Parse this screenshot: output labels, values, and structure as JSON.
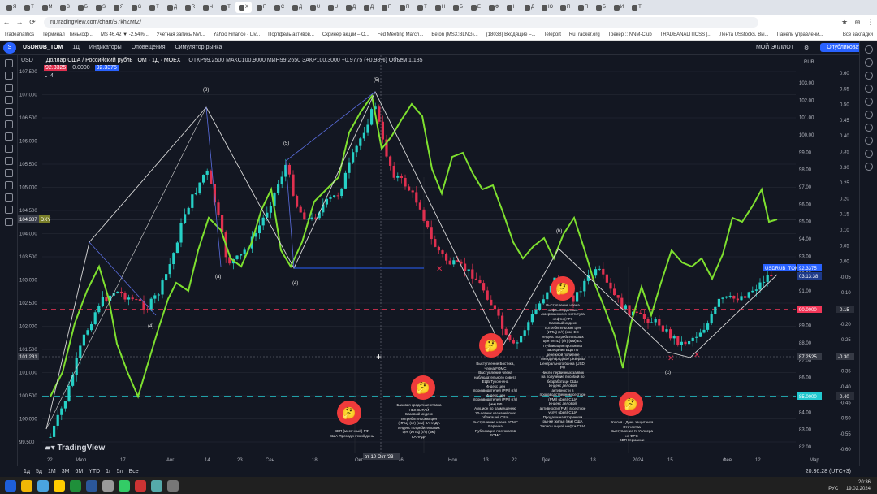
{
  "browser": {
    "tab_labels": [
      "Я",
      "Т",
      "М",
      "В",
      "Б",
      "S",
      "Я",
      "G",
      "T",
      "Д",
      "R",
      "Ч",
      "Т",
      "Х",
      "П",
      "С",
      "Д",
      "U",
      "U",
      "Д",
      "Д",
      "П",
      "П",
      "Т",
      "Н",
      "Б",
      "Е",
      "Ф",
      "Н",
      "Д",
      "Ю",
      "П",
      "П",
      "Б",
      "И",
      "Т"
    ],
    "url": "ru.tradingview.com/chart/S7khZMfZ/",
    "bookmarks": [
      "Tradeanalitics",
      "Терминал | Тинькоф...",
      "MS 46.42 ▼ -2.54%...",
      "Учетная запись NVI...",
      "Yahoo Finance - Liv...",
      "Портфель активов...",
      "Скринер акций – О...",
      "Fed Meeting March...",
      "Beton (MSX:BLNG)...",
      "(18038) Входящие –...",
      "Teleport",
      "RuTracker.org",
      "Трекер :: NNM-Club",
      "TRADEANALITICSS |...",
      "Лента USstocks. Вы...",
      "Панель управлени..."
    ],
    "bookmarks_all": "Все закладки"
  },
  "toolbar": {
    "symbol": "USDRUB_TOM",
    "interval": "1Д",
    "indicators": "Индикаторы",
    "alerts": "Оповещения",
    "replay": "Симулятор рынка",
    "layout_name": "МОЙ ЭЛЛИОТ",
    "publish": "Опубликовать"
  },
  "legend": {
    "title": "Доллар США / Российский рубль TOM · 1Д · MOEX",
    "ohlc": "ОТКР99.2500  МАКС100.9000  МИН99.2650  ЗАКР100.3000  +0.9775 (+0.98%)  Объём  1.185",
    "price_a": "92.3325",
    "price_b": "0.0000",
    "price_c": "92.3375",
    "indicator_count": "4"
  },
  "left_axis": {
    "currency": "USD",
    "labels": [
      "107.500",
      "107.000",
      "106.500",
      "106.000",
      "105.500",
      "105.000",
      "104.500",
      "104.000",
      "103.500",
      "103.000",
      "102.500",
      "102.000",
      "101.500",
      "101.000",
      "100.500",
      "100.000",
      "99.500"
    ],
    "hl_label": "104.387",
    "hl_tag": "DXY",
    "cursor_label": "101.231"
  },
  "right_axis": {
    "currency": "RUB",
    "labels": [
      "103.00",
      "102.00",
      "101.00",
      "100.00",
      "99.00",
      "98.00",
      "97.00",
      "96.00",
      "95.00",
      "94.00",
      "93.00",
      "92.00",
      "91.00",
      "90.00",
      "89.00",
      "88.00",
      "87.00",
      "86.00",
      "85.00",
      "84.00",
      "83.00",
      "82.00"
    ],
    "far_labels": [
      "0.60",
      "0.55",
      "0.50",
      "0.45",
      "0.40",
      "0.35",
      "0.30",
      "0.25",
      "0.20",
      "0.15",
      "0.10",
      "0.05",
      "0.00",
      "-0.05",
      "-0.10",
      "-0.15",
      "-0.20",
      "-0.25",
      "-0.30",
      "-0.35",
      "-0.40",
      "-0.45",
      "-0.50",
      "-0.55",
      "-0.60"
    ],
    "last_sym": "USDRUB_TOM",
    "last_price": "92.3375",
    "last_time": "03:13:38",
    "red_level": "90.0000",
    "red_level_far": "-0.15",
    "cursor": "87.2525",
    "cursor_far": "-0.30",
    "cyan_level": "85.0000",
    "cyan_level_far": "-0.40"
  },
  "time_axis": {
    "labels": [
      "22",
      "Июл",
      "17",
      "Авг",
      "14",
      "23",
      "Сен",
      "18",
      "Окт",
      "16",
      "Ноя",
      "13",
      "22",
      "Дек",
      "18",
      "2024",
      "15",
      "Фев",
      "12",
      "Мар"
    ],
    "cursor_label": "вт 10 Окт '23"
  },
  "waves": [
    "(3)",
    "(5)",
    "(5)",
    "(4)",
    "(a)",
    "(b)",
    "(4)",
    "(c)"
  ],
  "events": [
    {
      "note": "ВВП (месячный) РФ\nСША Президентский день"
    },
    {
      "note": "Базовая кредитная ставка\nНБК КИТАЙ\nБазовый индекс\nпотребительских цен\n(ИПЦ) (г/г) (мм) КАНАДА\nИндекс потребительских\nцен (ИПЦ) (г/г) (мм)\nКАНАДА"
    },
    {
      "note": "Выступление Бостика,\nчлена FOMC\nВыступление члена\nнаблюдательного совета\nЕЦБ Тухоннена\nИндекс цен\nпроизводителей (PPI) (г/г)\nИндекс цен\nпроизводителей (PPI) (г/г)\n(мм) РФ\nАукцион по размещению\n20-летних казначейских\nоблигаций США\nВыступление члена FOMC\nБаркина\nПубликация протоколов\nFOMC"
    },
    {
      "note": "Выступление члена\nнефть по данным\nАмериканского института\nнефти (API)\nБазовый индекс\nпотребительских цен\n(ИПЦ) (г/г) (мм) ЕС\nИндекс потребительских\nцен (ИПЦ) (г/г) (мм) ЕС\nПубликация протокола\nзаседания ЕЦБ по\nденежной политике\nМеждународные резервы\nЦентрального банка (USD)\nРФ\nЧисло первичных заявок\nна получение пособий по\nбезработице США\nИндекс деловой\nактивности в\nпроизводственном секторе\n(PMI) (фев) США\nИндекс деловой\nактивности (PMI) в секторе\nуслуг (фев) США\nПродажи на вторичном\nрынке жилья (мм) США\nЗапасы сырой нефти США"
    },
    {
      "note": "Россия - День защитника\nОтечества\nВыступление К. Уоллера\nиз ФРС\nВВП Германии"
    }
  ],
  "bottom_bar": {
    "ranges": [
      "1д",
      "5д",
      "1М",
      "3М",
      "6М",
      "YTD",
      "1г",
      "5л",
      "Все"
    ],
    "clock": "20:36:28 (UTC+3)"
  },
  "watermark": "TradingView",
  "taskbar": {
    "lang": "РУС",
    "time": "20:36",
    "date": "19.02.2024"
  },
  "colors": {
    "background": "#131722",
    "bull": "#26d0c6",
    "bear": "#e0304f",
    "overlay_line": "#7ee02f",
    "red_level": "#f23658",
    "cyan_level": "#22c9d0",
    "wave_line": "#d8d8d8",
    "accent": "#2962ff",
    "event_bubble": "#ef3b3b"
  }
}
